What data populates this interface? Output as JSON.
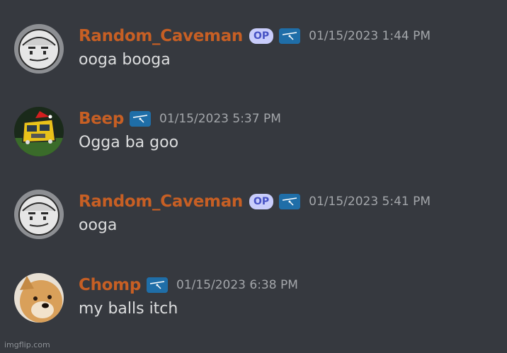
{
  "messages": [
    {
      "username": "Random_Caveman",
      "op": "OP",
      "timestamp": "01/15/2023 1:44 PM",
      "content": "ooga booga",
      "avatar": "caveman-avatar"
    },
    {
      "username": "Beep",
      "op": null,
      "timestamp": "01/15/2023 5:37 PM",
      "content": "Ogga ba goo",
      "avatar": "school-bus-avatar"
    },
    {
      "username": "Random_Caveman",
      "op": "OP",
      "timestamp": "01/15/2023 5:41 PM",
      "content": "ooga",
      "avatar": "caveman-avatar"
    },
    {
      "username": "Chomp",
      "op": null,
      "timestamp": "01/15/2023 6:38 PM",
      "content": "my balls itch",
      "avatar": "doge-avatar"
    }
  ],
  "watermark": "imgflip.com",
  "colors": {
    "background": "#36393f",
    "username": "#c75f24",
    "timestamp": "#a3a6aa",
    "content": "#dcddde",
    "op_badge_bg": "#c9cdfb",
    "op_badge_text": "#4752c4"
  }
}
